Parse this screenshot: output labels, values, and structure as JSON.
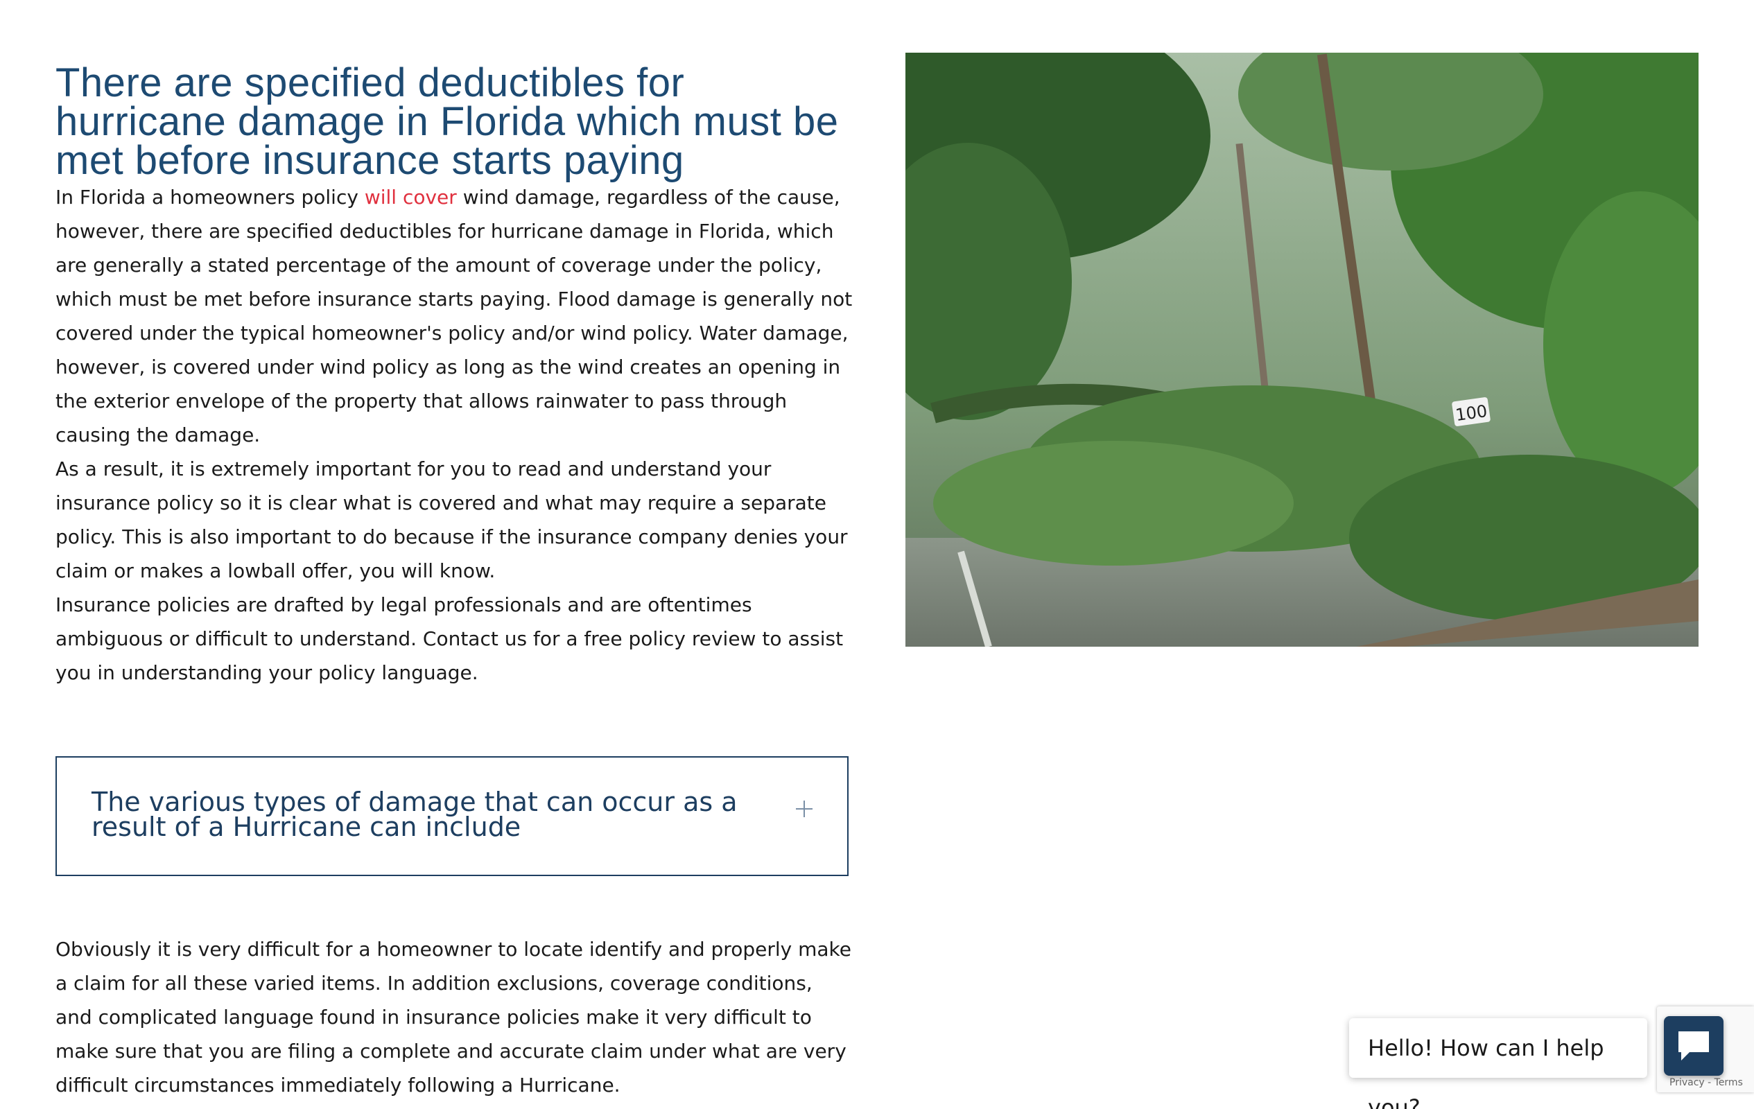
{
  "article": {
    "heading": "There are specified deductibles for hurricane damage in Florida which must be met before insurance starts paying",
    "p1_before": "In Florida a homeowners policy ",
    "p1_link": "will cover",
    "p1_after": " wind damage, regardless of the cause, however, there are specified deductibles for hurricane damage in Florida, which are generally a stated percentage of the amount of coverage under the policy, which must be met before insurance starts paying. Flood damage is generally not covered under the typical homeowner's policy and/or wind policy. Water damage, however, is covered under wind policy as long as the wind creates an opening in the exterior envelope of the property that allows rainwater to pass through causing the damage.",
    "p2": "As a result, it is extremely important for you to read and understand your insurance policy so it is clear what is covered and what may require a separate policy. This is also important to do because if the insurance company denies your claim or makes a lowball offer, you will know.",
    "p3": "Insurance policies are drafted by legal professionals and are oftentimes ambiguous or difficult to understand. Contact us for a free policy review to assist you in understanding your policy language.",
    "accordion_title": "The various types of damage that can occur as a result of a Hurricane can include",
    "p4": "Obviously it is very difficult for a homeowner to locate identify and properly make a claim for all these varied items. In addition exclusions, coverage conditions, and complicated language found in insurance policies make it very difficult to make sure that you are filing a complete and accurate claim under what are very difficult circumstances immediately following a Hurricane."
  },
  "image": {
    "subject": "storm-damaged trees and downed power lines across a road",
    "road_sign": "100"
  },
  "chat": {
    "greeting": "Hello! How can I help you?"
  },
  "recaptcha": {
    "links": "Privacy - Terms"
  },
  "colors": {
    "heading": "#1d4a72",
    "link": "#e0303e",
    "accordion_border": "#1d3e60",
    "chat_button": "#1d3e60"
  }
}
